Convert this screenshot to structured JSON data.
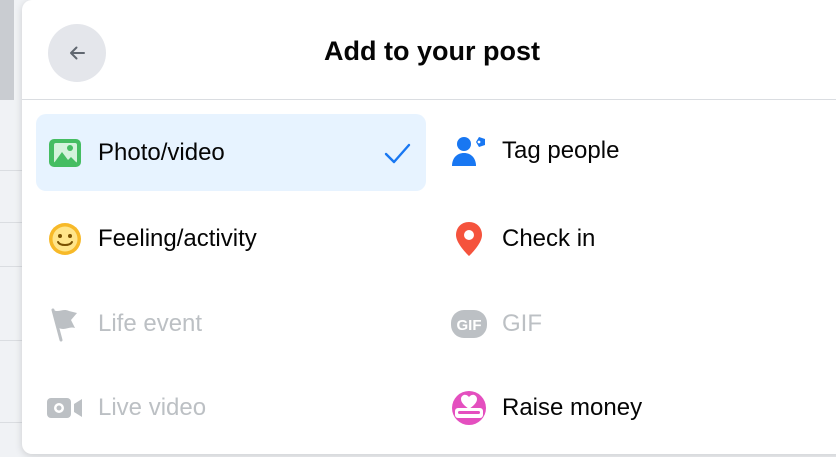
{
  "dialog": {
    "title": "Add to your post",
    "back_icon": "arrow-left-icon"
  },
  "options": {
    "photo_video": {
      "label": "Photo/video",
      "icon": "photo-icon",
      "selected": true
    },
    "tag_people": {
      "label": "Tag people",
      "icon": "tag-people-icon"
    },
    "feeling_activity": {
      "label": "Feeling/activity",
      "icon": "smiley-icon"
    },
    "check_in": {
      "label": "Check in",
      "icon": "location-pin-icon"
    },
    "life_event": {
      "label": "Life event",
      "icon": "flag-icon",
      "disabled": true
    },
    "gif": {
      "label": "GIF",
      "icon": "gif-icon",
      "disabled": true
    },
    "live_video": {
      "label": "Live video",
      "icon": "live-video-icon",
      "disabled": true
    },
    "raise_money": {
      "label": "Raise money",
      "icon": "donate-icon"
    }
  },
  "colors": {
    "selected_bg": "#e7f3ff",
    "accent_blue": "#1877f2",
    "green": "#45bd62",
    "yellow": "#f7b928",
    "red": "#f5533d",
    "pink": "#e44fbf",
    "disabled": "#bcc0c4"
  }
}
